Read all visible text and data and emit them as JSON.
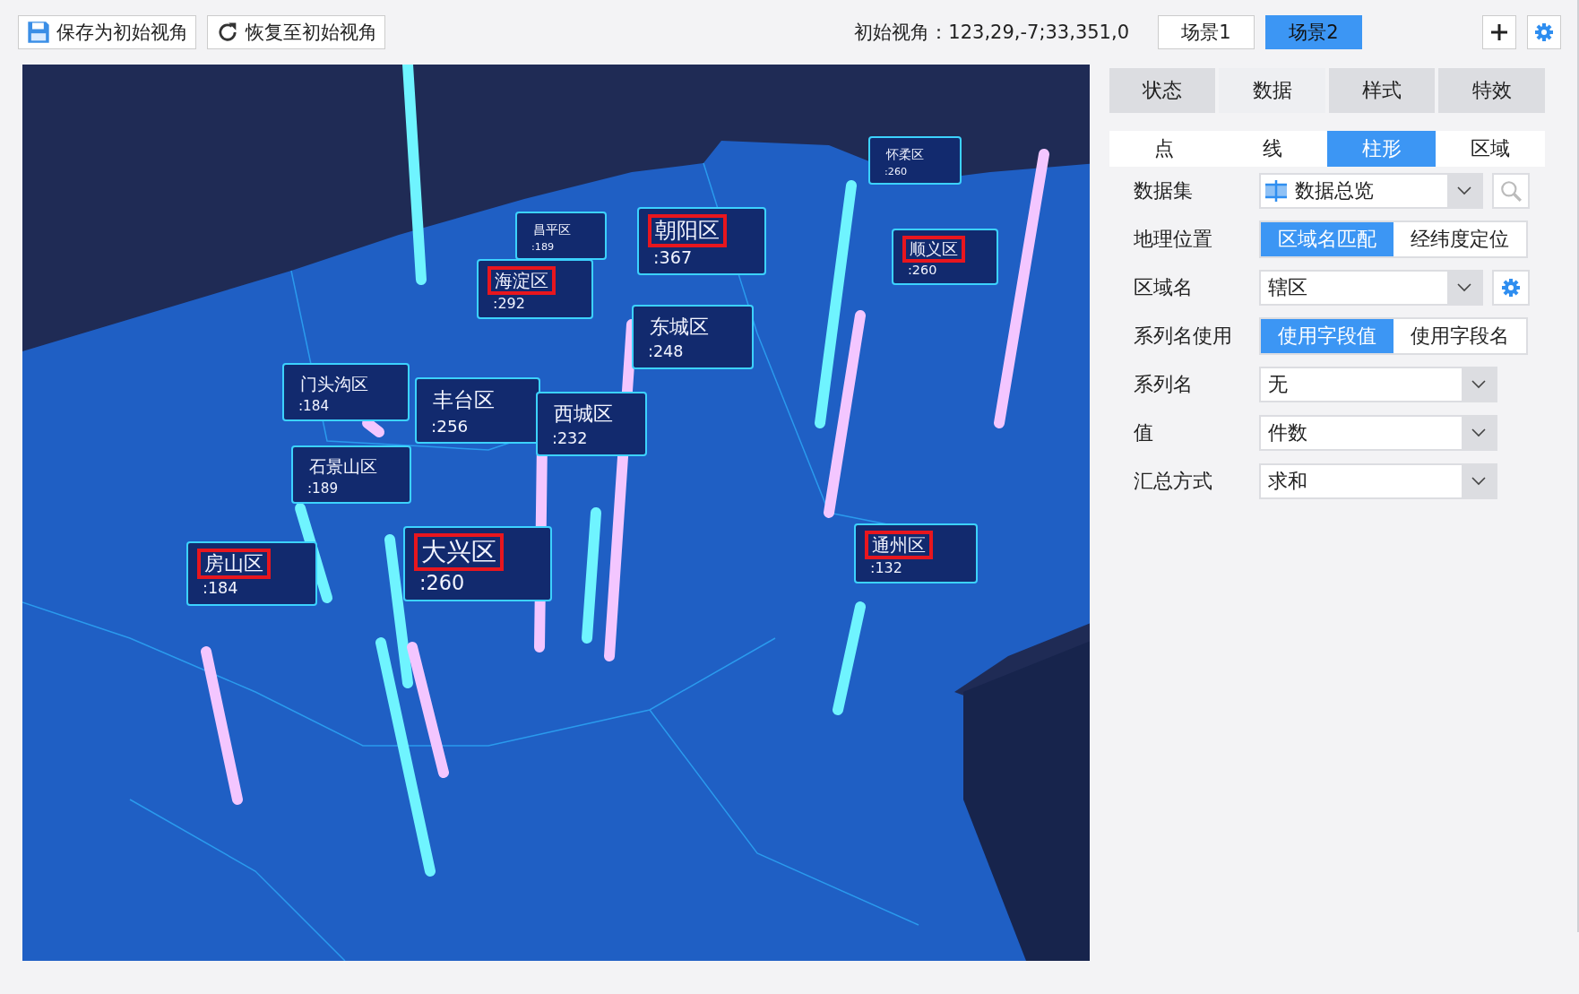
{
  "toolbar": {
    "buttons": [
      {
        "kind": "save",
        "label": "保存为初始视角"
      },
      {
        "kind": "restore",
        "label": "恢复至初始视角"
      }
    ],
    "view_info": "初始视角：123,29,-7;33,351,0",
    "scenes": [
      {
        "label": "场景1",
        "selected": false
      },
      {
        "label": "场景2",
        "selected": true
      }
    ]
  },
  "map": {
    "labels": [
      {
        "name": "昌平区",
        "value": ":189",
        "highlighted": false
      },
      {
        "name": "海淀区",
        "value": ":292",
        "highlighted": true
      },
      {
        "name": "朝阳区",
        "value": ":367",
        "highlighted": true
      },
      {
        "name": "怀柔区",
        "value": ":260",
        "highlighted": false
      },
      {
        "name": "顺义区",
        "value": ":260",
        "highlighted": true
      },
      {
        "name": "门头沟区",
        "value": ":184",
        "highlighted": false
      },
      {
        "name": "石景山区",
        "value": ":189",
        "highlighted": false
      },
      {
        "name": "丰台区",
        "value": ":256",
        "highlighted": false
      },
      {
        "name": "西城区",
        "value": ":232",
        "highlighted": false
      },
      {
        "name": "东城区",
        "value": ":248",
        "highlighted": false
      },
      {
        "name": "房山区",
        "value": ":184",
        "highlighted": true
      },
      {
        "name": "大兴区",
        "value": ":260",
        "highlighted": true
      },
      {
        "name": "通州区",
        "value": ":132",
        "highlighted": true
      }
    ]
  },
  "panel": {
    "tabs": [
      {
        "label": "状态",
        "selected": false
      },
      {
        "label": "数据",
        "selected": true
      },
      {
        "label": "样式",
        "selected": false
      },
      {
        "label": "特效",
        "selected": false
      }
    ],
    "subtabs": [
      {
        "label": "点",
        "selected": false
      },
      {
        "label": "线",
        "selected": false
      },
      {
        "label": "柱形",
        "selected": true
      },
      {
        "label": "区域",
        "selected": false
      }
    ],
    "fields": [
      {
        "kind": "select",
        "label": "数据集",
        "value": "数据总览",
        "dataset_icon": true,
        "extra_button": {
          "kind": "search"
        }
      },
      {
        "kind": "toggle",
        "label": "地理位置",
        "options": [
          {
            "label": "区域名匹配",
            "selected": true
          },
          {
            "label": "经纬度定位",
            "selected": false
          }
        ]
      },
      {
        "kind": "select",
        "label": "区域名",
        "value": "辖区",
        "extra_button": {
          "kind": "settings"
        }
      },
      {
        "kind": "toggle",
        "label": "系列名使用",
        "options": [
          {
            "label": "使用字段值",
            "selected": true
          },
          {
            "label": "使用字段名",
            "selected": false
          }
        ]
      },
      {
        "kind": "select",
        "label": "系列名",
        "value": "无"
      },
      {
        "kind": "select",
        "label": "值",
        "value": "件数"
      },
      {
        "kind": "select",
        "label": "汇总方式",
        "value": "求和"
      }
    ]
  }
}
